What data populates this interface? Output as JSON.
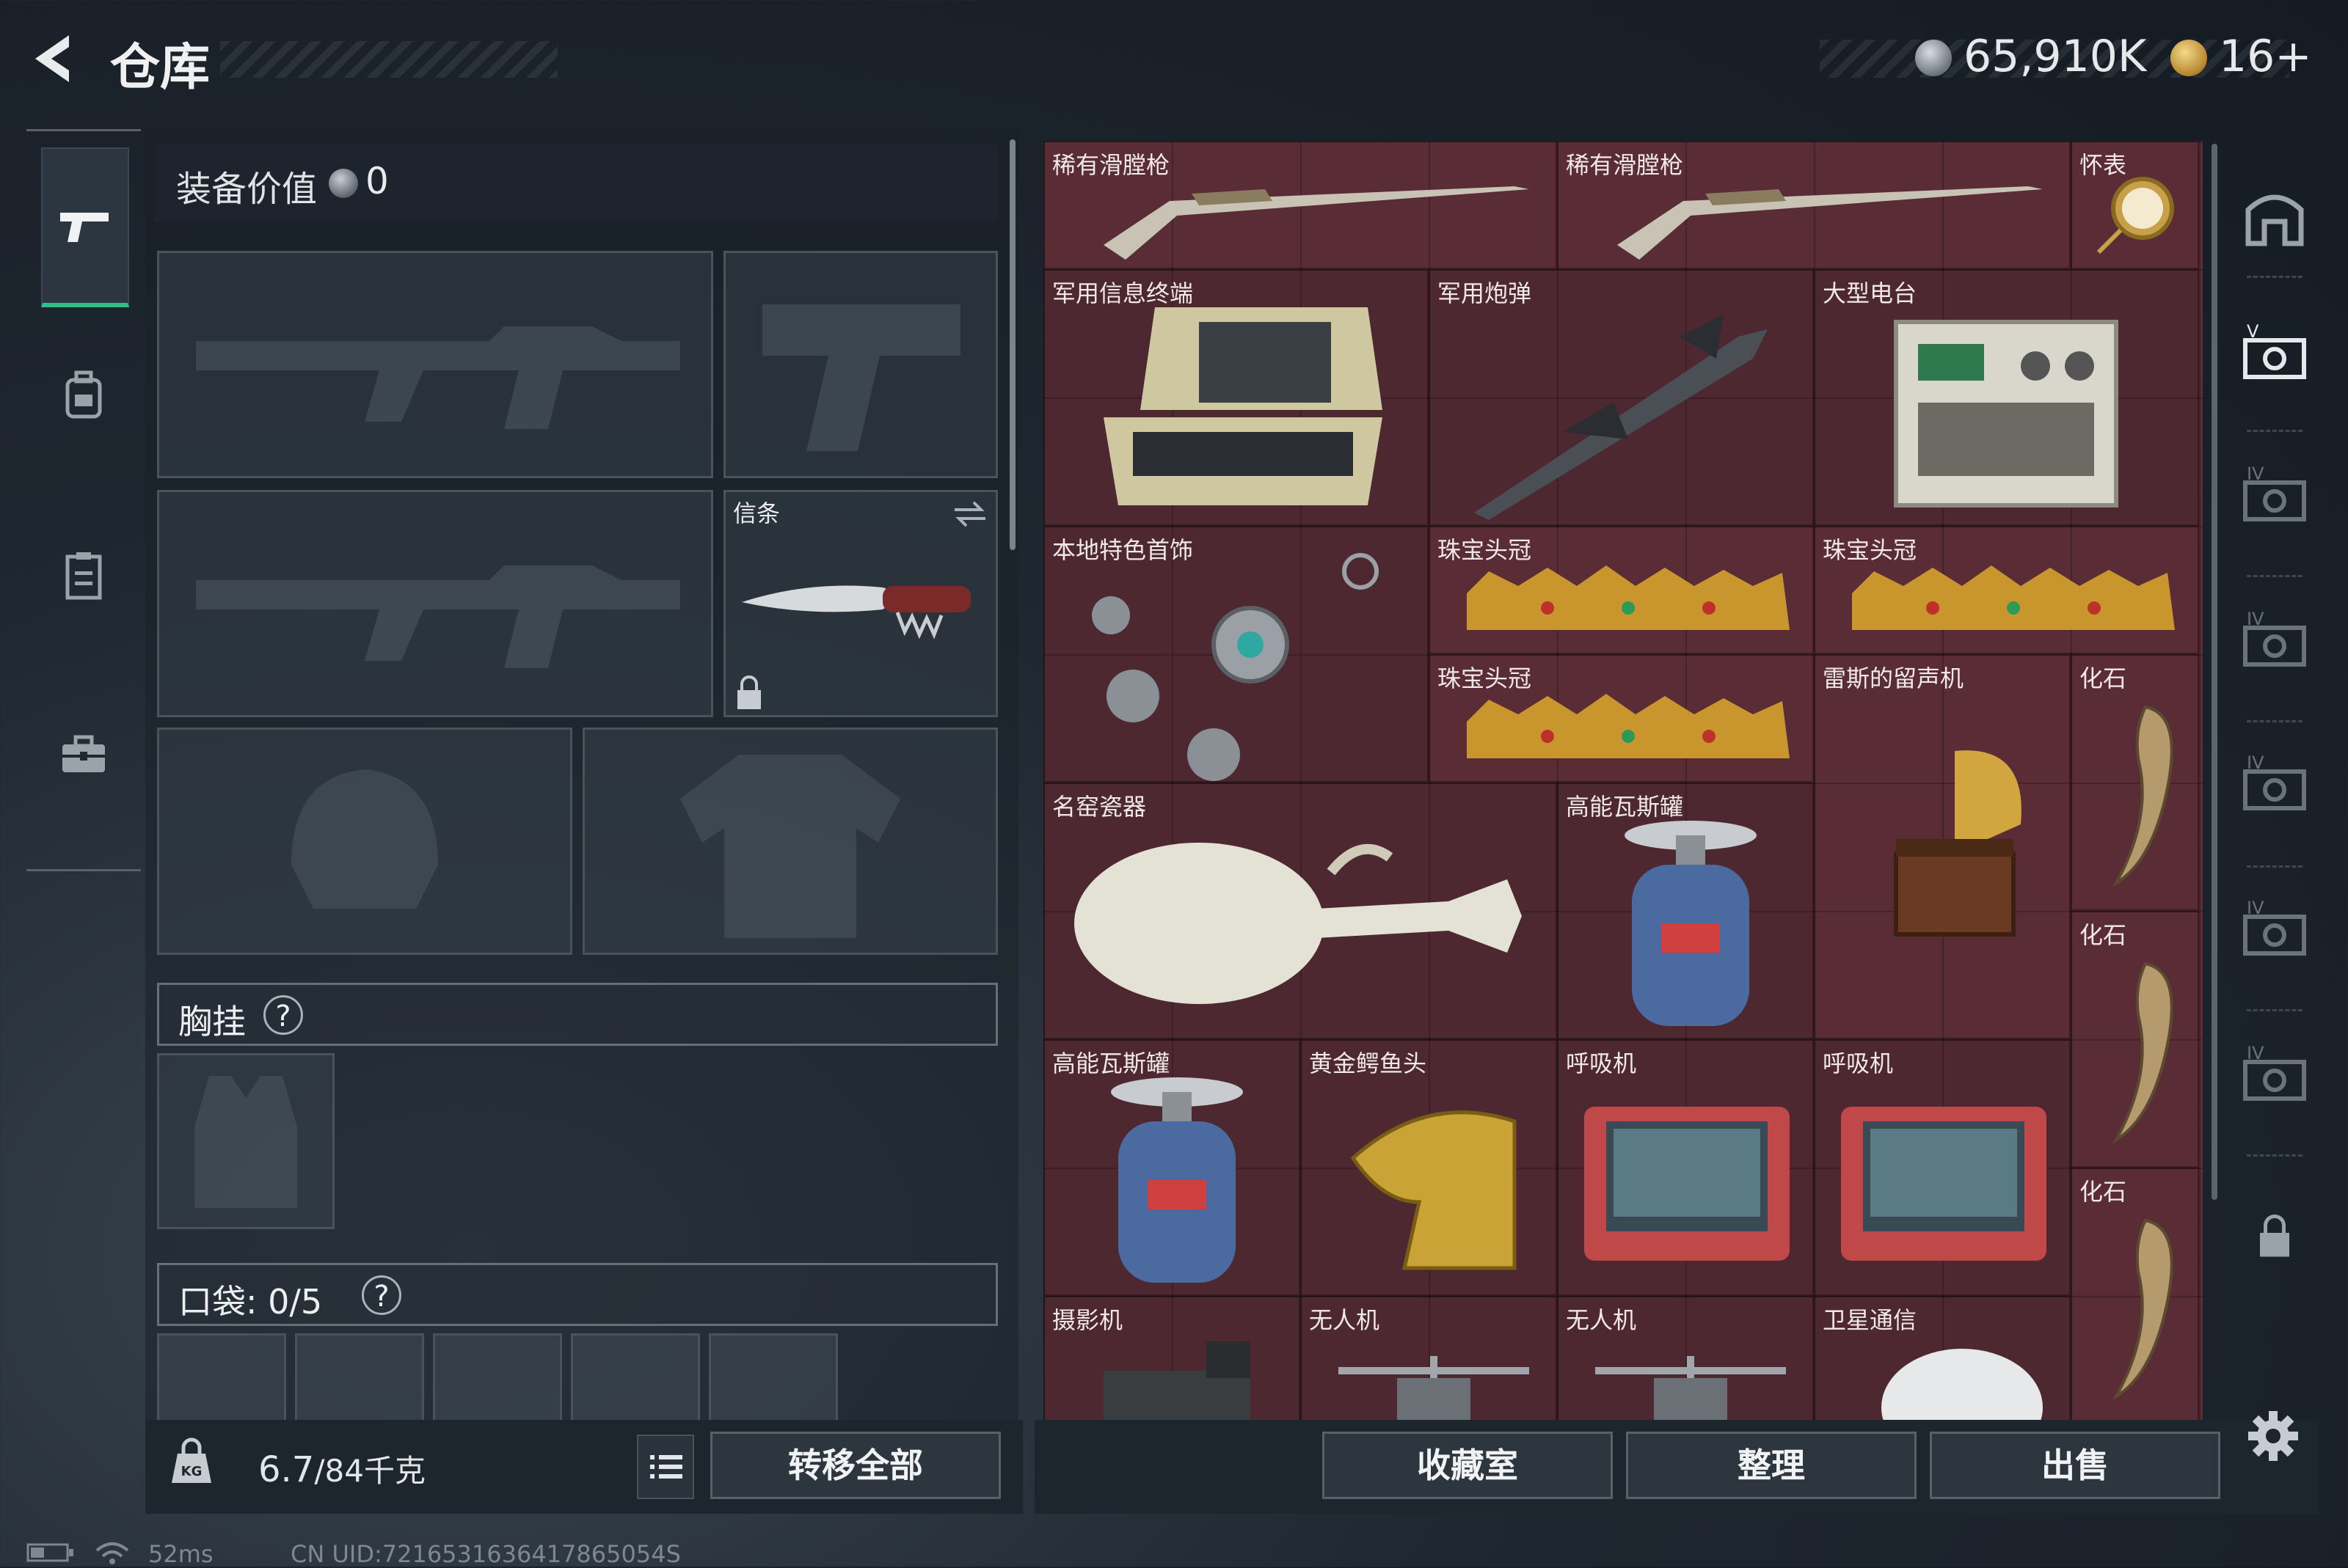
{
  "header": {
    "title": "仓库",
    "currency_value": "65,910K",
    "ticket_value": "16+"
  },
  "loadout": {
    "equipment_value_label": "装备价值",
    "equipment_value": "0",
    "melee_label": "信条",
    "chest_rig_label": "胸挂",
    "pocket_label": "口袋: 0/5",
    "help_mark": "?"
  },
  "bottom_left": {
    "weight_value": "6.7",
    "weight_total": "/84千克",
    "transfer_all": "转移全部",
    "weight_icon_text": "KG"
  },
  "bottom_right": {
    "collection_room": "收藏室",
    "organize": "整理",
    "sell": "出售"
  },
  "status": {
    "latency": "52ms",
    "uid": "CN UID:7216531636417865054S"
  },
  "storage_items": [
    {
      "label": "稀有滑膛枪",
      "icon": "musket"
    },
    {
      "label": "稀有滑膛枪",
      "icon": "musket"
    },
    {
      "label": "怀表",
      "icon": "pocket-watch"
    },
    {
      "label": "军用信息终端",
      "icon": "terminal"
    },
    {
      "label": "军用炮弹",
      "icon": "missile"
    },
    {
      "label": "大型电台",
      "icon": "radio"
    },
    {
      "label": "本地特色首饰",
      "icon": "jewelry"
    },
    {
      "label": "珠宝头冠",
      "icon": "tiara"
    },
    {
      "label": "珠宝头冠",
      "icon": "tiara"
    },
    {
      "label": "珠宝头冠",
      "icon": "tiara"
    },
    {
      "label": "雷斯的留声机",
      "icon": "gramophone"
    },
    {
      "label": "化石",
      "icon": "fossil"
    },
    {
      "label": "名窑瓷器",
      "icon": "porcelain"
    },
    {
      "label": "高能瓦斯罐",
      "icon": "gas-canister"
    },
    {
      "label": "化石",
      "icon": "fossil"
    },
    {
      "label": "高能瓦斯罐",
      "icon": "gas-canister"
    },
    {
      "label": "黄金鳄鱼头",
      "icon": "gold-croc"
    },
    {
      "label": "呼吸机",
      "icon": "ventilator"
    },
    {
      "label": "呼吸机",
      "icon": "ventilator"
    },
    {
      "label": "化石",
      "icon": "fossil"
    },
    {
      "label": "摄影机",
      "icon": "camera"
    },
    {
      "label": "无人机",
      "icon": "drone"
    },
    {
      "label": "无人机",
      "icon": "drone"
    },
    {
      "label": "卫星通信",
      "icon": "satellite"
    }
  ],
  "colors": {
    "grid_bg": "#5a2c36",
    "accent_green": "#2fc08a"
  }
}
